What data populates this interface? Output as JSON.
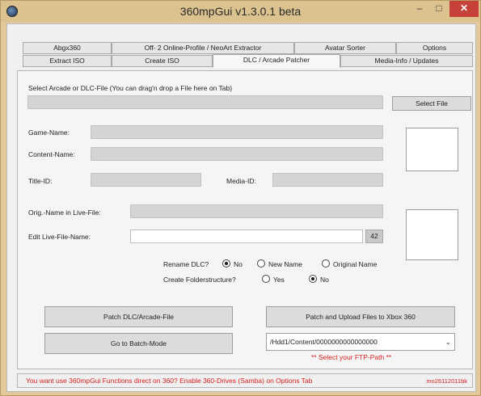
{
  "window": {
    "title": "360mpGui v1.3.0.1 beta",
    "minimize_glyph": "–",
    "maximize_glyph": "□",
    "close_glyph": "✕"
  },
  "tabs_row1": [
    {
      "label": "Abgx360"
    },
    {
      "label": "Off- 2 Online-Profile / NeoArt Extractor"
    },
    {
      "label": "Avatar Sorter"
    },
    {
      "label": "Options"
    }
  ],
  "tabs_row2": [
    {
      "label": "Extract ISO"
    },
    {
      "label": "Create ISO"
    },
    {
      "label": "DLC / Arcade Patcher",
      "active": true
    },
    {
      "label": "Media-Info / Updates"
    }
  ],
  "dlc": {
    "select_label": "Select Arcade or DLC-File (You can drag'n drop a File here on Tab)",
    "select_file_button": "Select File",
    "game_name_label": "Game-Name:",
    "content_name_label": "Content-Name:",
    "title_id_label": "Title-ID:",
    "media_id_label": "Media-ID:",
    "orig_name_label": "Orig.-Name in Live-File:",
    "edit_live_name_label": "Edit Live-File-Name:",
    "char_counter": "42",
    "rename_label": "Rename DLC?",
    "rename_options": [
      "No",
      "New Name",
      "Original Name"
    ],
    "rename_selected": "No",
    "folder_label": "Create Folderstructure?",
    "folder_options": [
      "Yes",
      "No"
    ],
    "folder_selected": "No",
    "patch_button": "Patch DLC/Arcade-File",
    "upload_button": "Patch and Upload Files to Xbox 360",
    "batch_button": "Go to Batch-Mode",
    "ftp_path_value": "/Hdd1/Content/0000000000000000",
    "ftp_hint": "** Select your FTP-Path **"
  },
  "status": {
    "message": "You want use 360mpGui Functions direct on 360? Enable 360-Drives (Samba) on Options Tab",
    "version": "mo26112011bk"
  },
  "colors": {
    "accent_warning": "#d52020",
    "close_button": "#c7413b",
    "window_frame": "#e2c89a"
  }
}
